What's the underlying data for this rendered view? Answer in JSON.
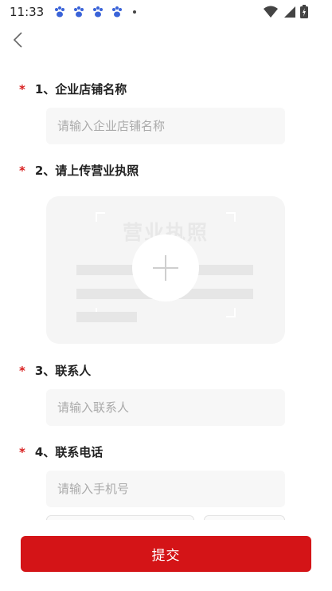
{
  "status_bar": {
    "time": "11:33"
  },
  "sections": [
    {
      "star": "*",
      "title": "1、企业店铺名称",
      "placeholder": "请输入企业店铺名称",
      "value": ""
    },
    {
      "star": "*",
      "title": "2、请上传营业执照",
      "upload_watermark": "营业执照"
    },
    {
      "star": "*",
      "title": "3、联系人",
      "placeholder": "请输入联系人",
      "value": ""
    },
    {
      "star": "*",
      "title": "4、联系电话",
      "placeholder": "请输入手机号",
      "value": ""
    }
  ],
  "submit": {
    "label": "提交"
  },
  "colors": {
    "accent": "#d41417",
    "required_star": "#d81e1e",
    "input_bg": "#f7f7f7"
  },
  "icons": [
    "back-chevron-icon",
    "paw-notification-icon",
    "wifi-icon",
    "signal-icon",
    "battery-icon",
    "plus-icon"
  ]
}
